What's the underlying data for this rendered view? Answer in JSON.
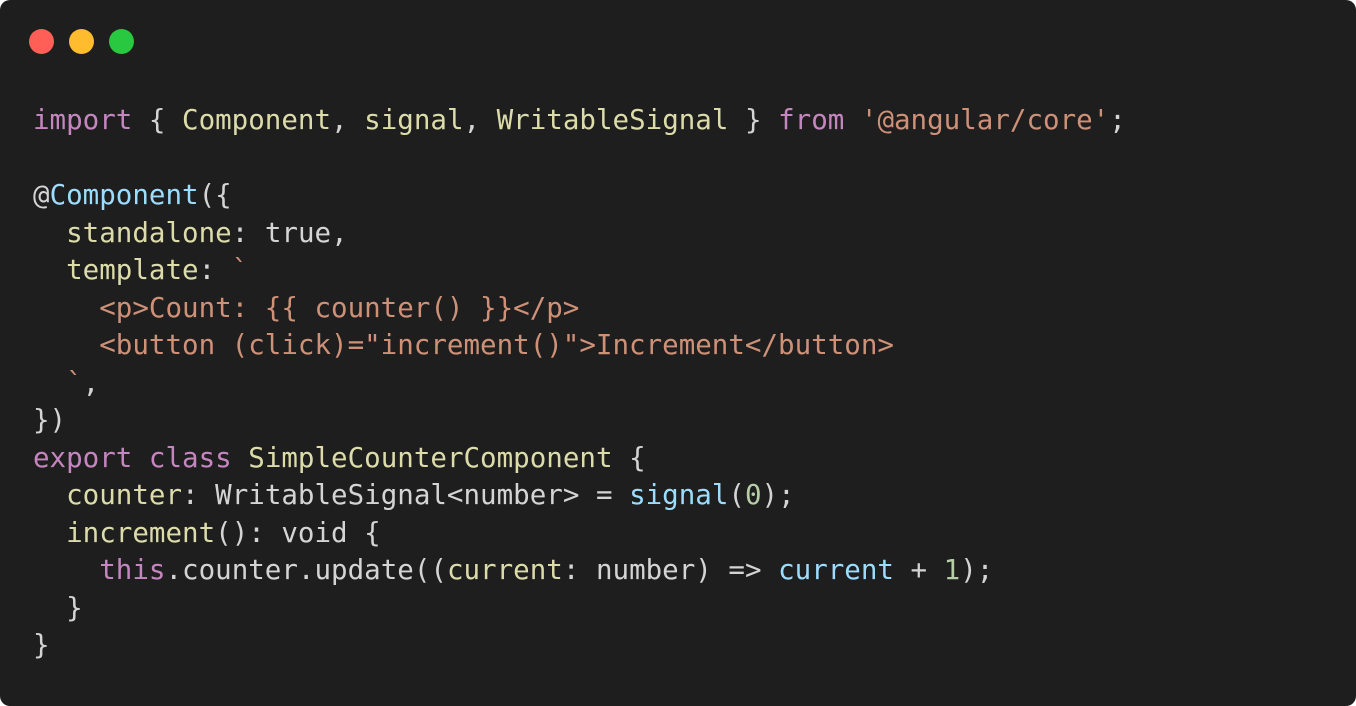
{
  "window": {
    "controls": [
      {
        "name": "close",
        "color": "#ff5f57"
      },
      {
        "name": "minimize",
        "color": "#febc2e"
      },
      {
        "name": "maximize",
        "color": "#28c840"
      }
    ]
  },
  "colors": {
    "background": "#1e1e1e",
    "keyword": "#c586c0",
    "identifier": "#dcdcaa",
    "string": "#ce9178",
    "decorator": "#9cdcfe",
    "number": "#b5cea8",
    "default": "#d4d4d4"
  },
  "code": {
    "language": "typescript",
    "lines": [
      [
        {
          "t": "kw",
          "v": "import"
        },
        {
          "t": "punct",
          "v": " { "
        },
        {
          "t": "ident",
          "v": "Component"
        },
        {
          "t": "punct",
          "v": ", "
        },
        {
          "t": "ident",
          "v": "signal"
        },
        {
          "t": "punct",
          "v": ", "
        },
        {
          "t": "ident",
          "v": "WritableSignal"
        },
        {
          "t": "punct",
          "v": " } "
        },
        {
          "t": "kw",
          "v": "from"
        },
        {
          "t": "punct",
          "v": " "
        },
        {
          "t": "str",
          "v": "'@angular/core'"
        },
        {
          "t": "punct",
          "v": ";"
        }
      ],
      [],
      [
        {
          "t": "punct",
          "v": "@"
        },
        {
          "t": "dec",
          "v": "Component"
        },
        {
          "t": "punct",
          "v": "({"
        }
      ],
      [
        {
          "t": "punct",
          "v": "  "
        },
        {
          "t": "prop",
          "v": "standalone"
        },
        {
          "t": "punct",
          "v": ": "
        },
        {
          "t": "plain",
          "v": "true"
        },
        {
          "t": "punct",
          "v": ","
        }
      ],
      [
        {
          "t": "punct",
          "v": "  "
        },
        {
          "t": "prop",
          "v": "template"
        },
        {
          "t": "punct",
          "v": ": "
        },
        {
          "t": "str",
          "v": "`"
        }
      ],
      [
        {
          "t": "str",
          "v": "    <p>Count: {{ counter() }}</p>"
        }
      ],
      [
        {
          "t": "str",
          "v": "    <button (click)=\"increment()\">Increment</button>"
        }
      ],
      [
        {
          "t": "str",
          "v": "  `"
        },
        {
          "t": "punct",
          "v": ","
        }
      ],
      [
        {
          "t": "punct",
          "v": "})"
        }
      ],
      [
        {
          "t": "kw",
          "v": "export"
        },
        {
          "t": "punct",
          "v": " "
        },
        {
          "t": "kw",
          "v": "class"
        },
        {
          "t": "punct",
          "v": " "
        },
        {
          "t": "ident",
          "v": "SimpleCounterComponent"
        },
        {
          "t": "punct",
          "v": " {"
        }
      ],
      [
        {
          "t": "punct",
          "v": "  "
        },
        {
          "t": "prop",
          "v": "counter"
        },
        {
          "t": "punct",
          "v": ": WritableSignal<number> = "
        },
        {
          "t": "fn",
          "v": "signal"
        },
        {
          "t": "punct",
          "v": "("
        },
        {
          "t": "num",
          "v": "0"
        },
        {
          "t": "punct",
          "v": ");"
        }
      ],
      [
        {
          "t": "punct",
          "v": "  "
        },
        {
          "t": "prop",
          "v": "increment"
        },
        {
          "t": "punct",
          "v": "(): void {"
        }
      ],
      [
        {
          "t": "punct",
          "v": "    "
        },
        {
          "t": "kw",
          "v": "this"
        },
        {
          "t": "punct",
          "v": ".counter.update(("
        },
        {
          "t": "prop",
          "v": "current"
        },
        {
          "t": "punct",
          "v": ": number) => "
        },
        {
          "t": "fn",
          "v": "current"
        },
        {
          "t": "punct",
          "v": " + "
        },
        {
          "t": "num",
          "v": "1"
        },
        {
          "t": "punct",
          "v": ");"
        }
      ],
      [
        {
          "t": "punct",
          "v": "  }"
        }
      ],
      [
        {
          "t": "punct",
          "v": "}"
        }
      ]
    ]
  }
}
